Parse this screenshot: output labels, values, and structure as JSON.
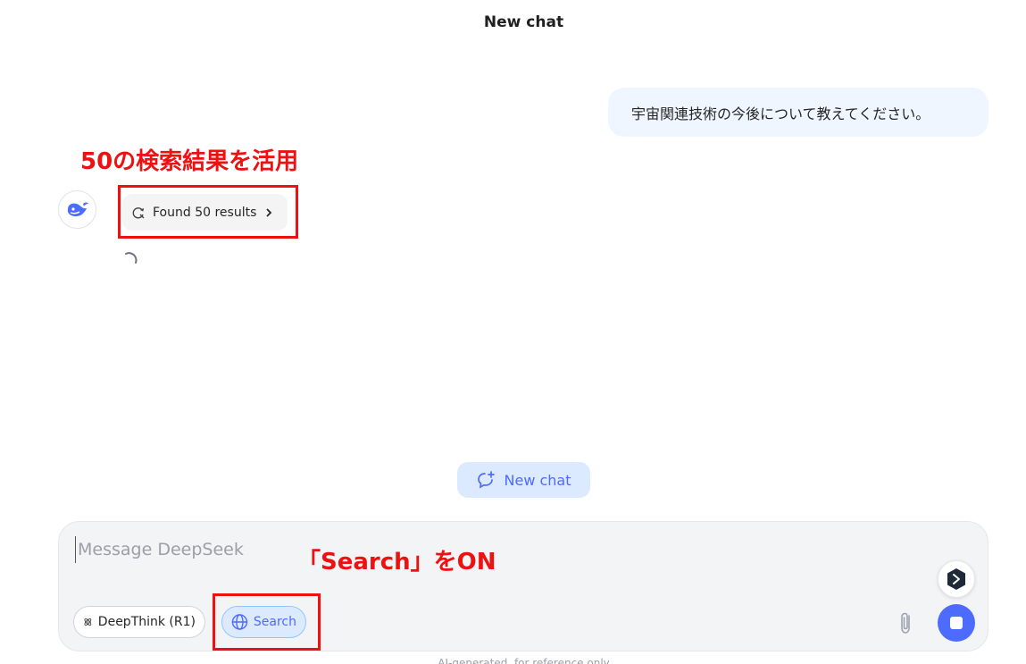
{
  "header": {
    "title": "New chat"
  },
  "user_message": {
    "text": "宇宙関連技術の今後について教えてください。"
  },
  "annotations": {
    "results_note": "50の検索結果を活用",
    "search_note": "「Search」をON",
    "color": "#ee1111"
  },
  "assistant": {
    "avatar_icon": "deepseek-whale-icon",
    "results_chip": {
      "label": "Found 50 results",
      "icon": "search-refresh-icon",
      "arrow": "chevron-right-icon"
    },
    "status": "loading"
  },
  "new_chat_button": {
    "label": "New chat"
  },
  "input": {
    "placeholder": "Message DeepSeek",
    "value": "",
    "deepthink_label": "DeepThink (R1)",
    "search_label": "Search",
    "search_active": true
  },
  "footer": {
    "note": "AI-generated, for reference only"
  },
  "colors": {
    "accent": "#4d6bfe",
    "bubble": "#eff6ff",
    "chip_active_bg": "#dbeafe"
  }
}
